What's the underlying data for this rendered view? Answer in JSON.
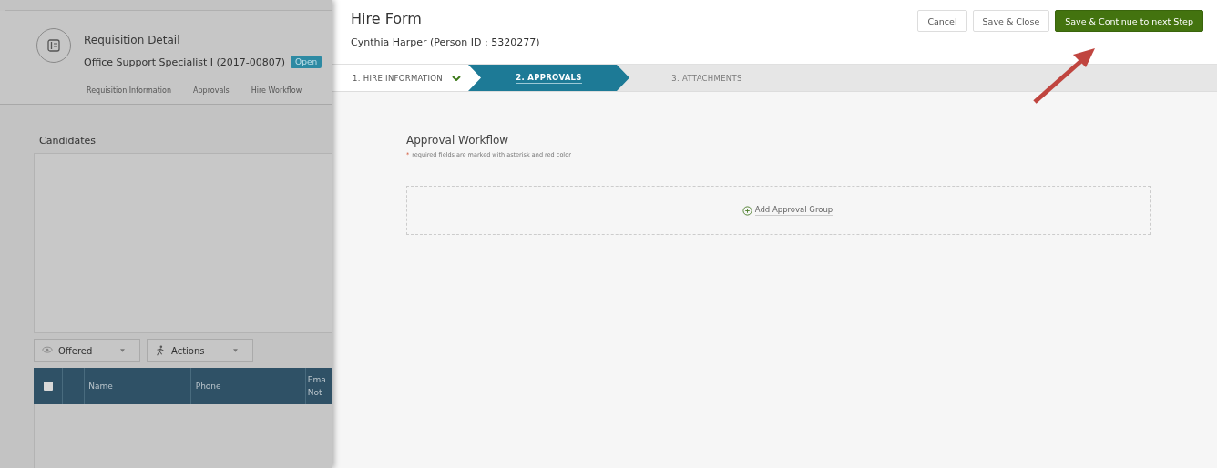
{
  "background_page": {
    "title": "Requisition Detail",
    "requisition": "Office Support Specialist I (2017-00807)",
    "status_badge": "Open",
    "nav_links": [
      "Requisition Information",
      "Approvals",
      "Hire Workflow"
    ],
    "candidates_title": "Candidates",
    "filters": [
      {
        "kind": "view",
        "label": "Offered"
      },
      {
        "kind": "actions",
        "label": "Actions"
      }
    ],
    "table": {
      "select_all_checked": false,
      "columns": [
        "",
        "Name",
        "Phone",
        "Ema Not"
      ]
    }
  },
  "modal": {
    "title": "Hire Form",
    "subtitle": "Cynthia Harper (Person ID : 5320277)",
    "buttons": [
      {
        "label": "Cancel",
        "kind": "default"
      },
      {
        "label": "Save & Close",
        "kind": "default"
      },
      {
        "label": "Save & Continue to next Step",
        "kind": "primary"
      }
    ],
    "steps": [
      {
        "label": "1. HIRE INFORMATION",
        "selected": false,
        "completed": true
      },
      {
        "label": "2. APPROVALS",
        "selected": true,
        "completed": false
      },
      {
        "label": "3. ATTACHMENTS",
        "selected": false,
        "completed": false
      }
    ],
    "section_title": "Approval Workflow",
    "required_mark": "*",
    "required_note": "required fields are marked with asterisk and red color",
    "add_group_link": "Add Approval Group"
  },
  "annotation": {
    "kind": "arrow"
  }
}
